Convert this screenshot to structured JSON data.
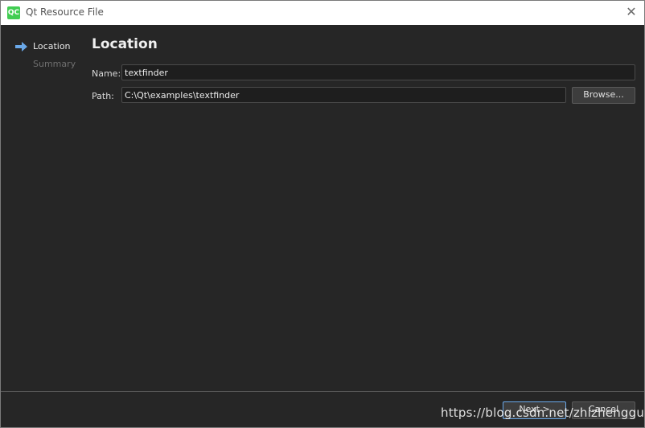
{
  "window": {
    "title": "Qt Resource File"
  },
  "sidebar": {
    "steps": [
      {
        "label": "Location",
        "active": true
      },
      {
        "label": "Summary",
        "active": false
      }
    ]
  },
  "page": {
    "heading": "Location",
    "name_label": "Name:",
    "name_value": "textfinder",
    "path_label": "Path:",
    "path_value": "C:\\Qt\\examples\\textfinder",
    "browse_label": "Browse..."
  },
  "footer": {
    "next_label": "Next >",
    "cancel_label": "Cancel"
  },
  "watermark": "https://blog.csdn.net/zhizhengguan",
  "icons": {
    "step_arrow": "arrow-right-icon",
    "logo": "qt-logo-icon",
    "close": "close-icon"
  },
  "colors": {
    "accent": "#41cd52",
    "arrow": "#6aa8e8"
  }
}
